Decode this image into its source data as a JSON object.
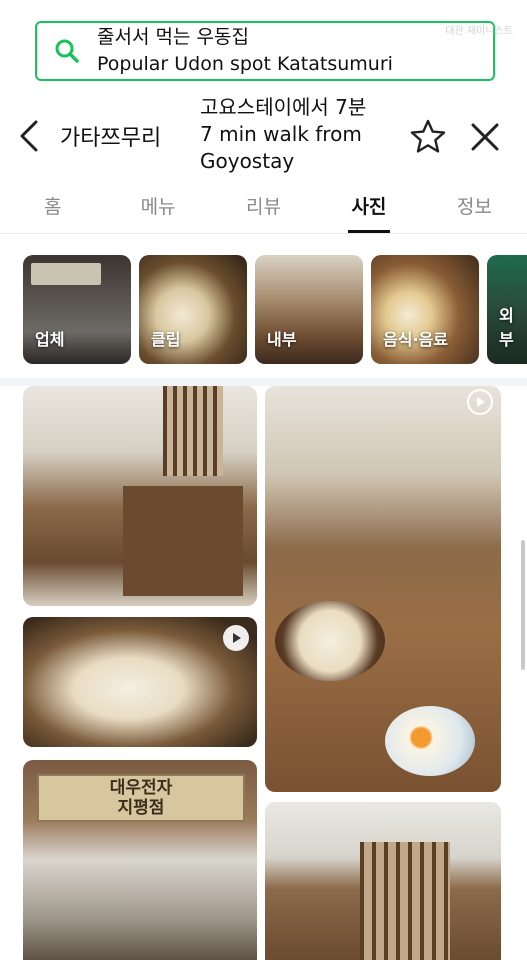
{
  "search": {
    "line1": "줄서서 먹는 우동집",
    "line2": "Popular Udon spot Katatsumuri",
    "icon": "search-icon",
    "accent": "#19c25a"
  },
  "watermark": "대한 재미니스트",
  "header": {
    "place_name": "가타쯔무리",
    "walk_line1": "고요스테이에서 7분",
    "walk_line2": "7 min walk from",
    "walk_line3": "Goyostay"
  },
  "tabs": [
    {
      "label": "홈",
      "active": false
    },
    {
      "label": "메뉴",
      "active": false
    },
    {
      "label": "리뷰",
      "active": false
    },
    {
      "label": "사진",
      "active": true
    },
    {
      "label": "정보",
      "active": false
    }
  ],
  "categories": [
    {
      "label": "업체"
    },
    {
      "label": "클립"
    },
    {
      "label": "내부"
    },
    {
      "label": "음식·음료"
    },
    {
      "label": "외부"
    }
  ],
  "photos": {
    "sign_line1": "대우전자",
    "sign_line2": "지평점"
  }
}
